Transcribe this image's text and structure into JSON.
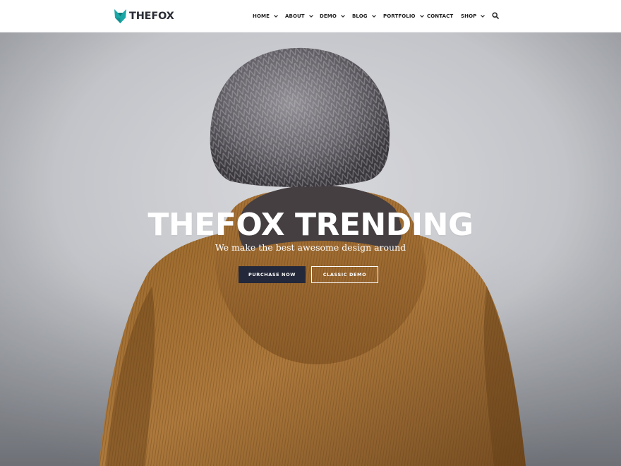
{
  "brand": {
    "name": "THEFOX",
    "accent": "#1aa7a5"
  },
  "nav": {
    "home": "HOME",
    "about": "ABOUT",
    "demo": "DEMO",
    "blog": "BLOG",
    "portfolio": "PORTFOLIO",
    "contact": "CONTACT",
    "shop": "SHOP",
    "search_icon": "search-icon"
  },
  "hero": {
    "title": "THEFOX TRENDING",
    "subtitle": "We make the best awesome design around",
    "primary_button": "PURCHASE NOW",
    "secondary_button": "CLASSIC DEMO",
    "primary_button_color": "#23283a"
  }
}
